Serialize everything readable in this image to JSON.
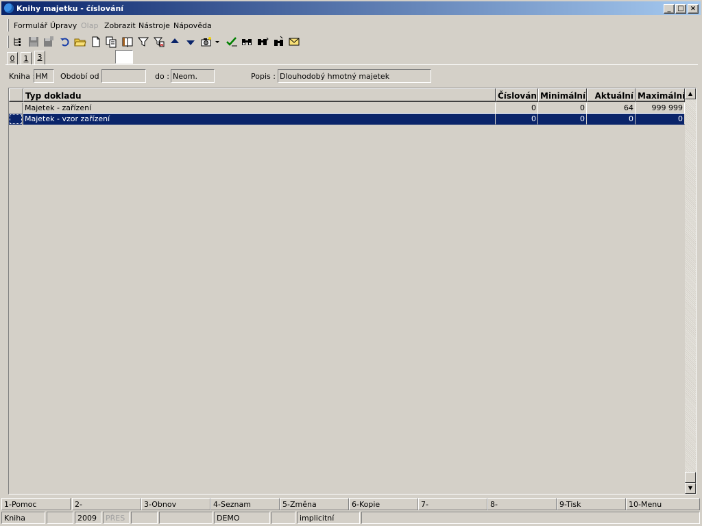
{
  "window": {
    "title": "Knihy majetku - číslování",
    "controls": {
      "minimize": "_",
      "maximize": "□",
      "close": "×"
    }
  },
  "menu": [
    "Formulář",
    "Úpravy",
    "Olap",
    "Zobrazit",
    "Nástroje",
    "Nápověda"
  ],
  "menu_disabled": [
    "Olap"
  ],
  "toolbar_icons": [
    "tree-icon",
    "save-icon",
    "save-as-icon",
    "undo-icon",
    "open-folder-icon",
    "new-document-icon",
    "copy-icon",
    "book-icon",
    "filter-icon",
    "filter-clear-icon",
    "arrow-up-icon",
    "arrow-down-icon",
    "camera-icon",
    "dropdown-arrow-icon",
    "check-icon",
    "binoculars-icon",
    "binoculars-next-icon",
    "binoculars-replace-icon",
    "mail-icon"
  ],
  "tabs": [
    {
      "label": "0",
      "active": false
    },
    {
      "label": "1",
      "active": false
    },
    {
      "label": "3",
      "active": true
    }
  ],
  "header": {
    "kniha_label": "Kniha :",
    "kniha_value": "HM",
    "obdobi_od_label": "Období od :",
    "obdobi_od_value": "",
    "do_label": "do :",
    "do_value": "Neom.",
    "popis_label": "Popis :",
    "popis_value": "Dlouhodobý hmotný majetek"
  },
  "table": {
    "columns": [
      "Typ dokladu",
      "Číslování",
      "Minimální",
      "Aktuální",
      "Maximální"
    ],
    "rows": [
      {
        "typ": "Majetek - zařízení",
        "cislovani": "0",
        "minimalni": "0",
        "aktualni": "64",
        "maximalni": "999 999",
        "selected": false
      },
      {
        "typ": "Majetek - vzor zařízení",
        "cislovani": "0",
        "minimalni": "0",
        "aktualni": "0",
        "maximalni": "0",
        "selected": true
      }
    ]
  },
  "function_keys": [
    "1-Pomoc",
    "2-",
    "3-Obnov",
    "4-Seznam",
    "5-Změna",
    "6-Kopie",
    "7-",
    "8-",
    "9-Tisk",
    "10-Menu"
  ],
  "status_bar": [
    "Kniha",
    "",
    "2009",
    "PŘES",
    "",
    "",
    "DEMO",
    "",
    "implicitní",
    ""
  ],
  "colors": {
    "selection": "#0a246a",
    "title_gradient_start": "#0a246a",
    "title_gradient_end": "#a6caf0",
    "face": "#d4d0c8"
  }
}
